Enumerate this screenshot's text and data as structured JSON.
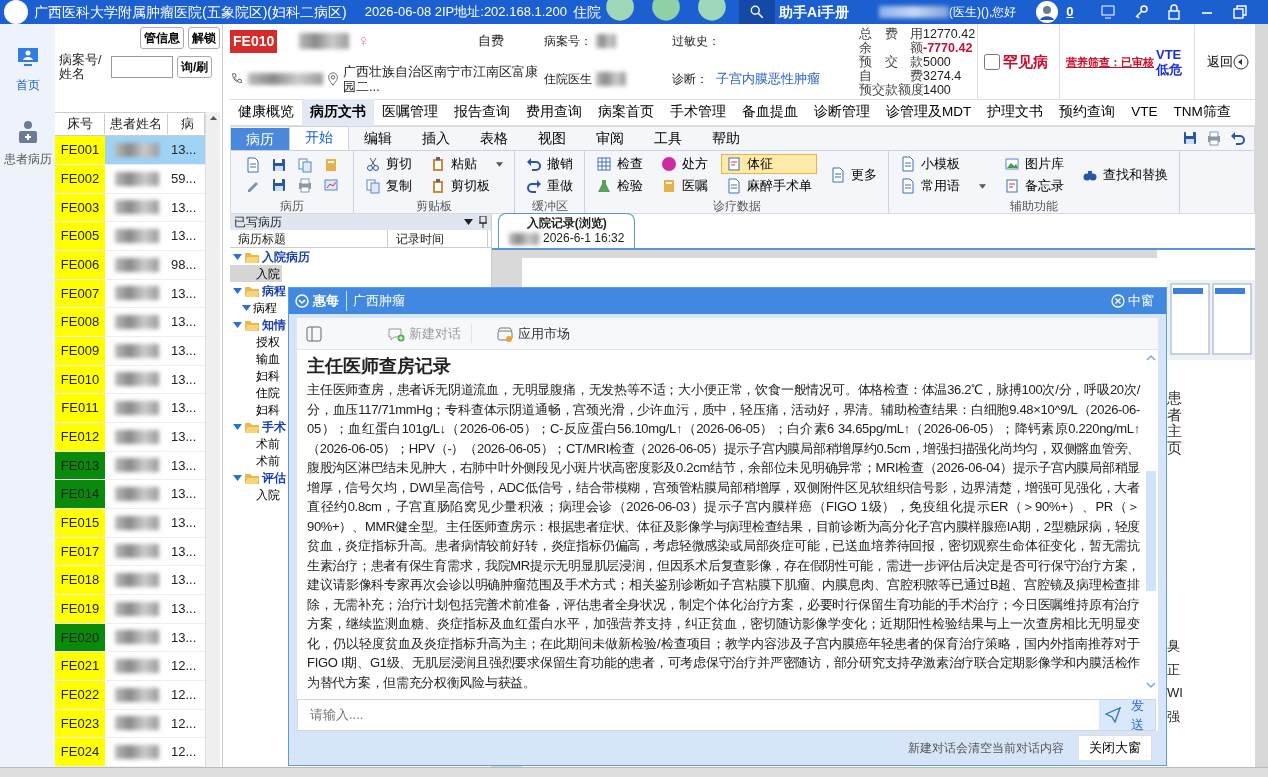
{
  "titlebar": {
    "title": "广西医科大学附属肿瘤医院(五象院区)(妇科二病区)",
    "info": "2026-06-08 2IP地址:202.168.1.200",
    "ward": "住院",
    "assistant": "助手Ai手册",
    "greeting": "(医生)(),您好",
    "notifications": "0"
  },
  "nav": [
    {
      "label": "首页",
      "selected": true
    },
    {
      "label": "患者病历",
      "selected": false
    }
  ],
  "patient_panel": {
    "buttons": [
      "管信息",
      "解锁"
    ],
    "search_label": "病案号/姓名",
    "search_button": "询/刷",
    "columns": [
      "床号",
      "患者姓名",
      "病"
    ],
    "rows": [
      {
        "bed": "FE001",
        "col3": "13...",
        "color": "#ffff00",
        "selected": true
      },
      {
        "bed": "FE002",
        "col3": "59...",
        "color": "#ffff00",
        "selected": false
      },
      {
        "bed": "FE003",
        "col3": "13...",
        "color": "#ffff00",
        "selected": false
      },
      {
        "bed": "FE005",
        "col3": "13...",
        "color": "#ffff00",
        "selected": false
      },
      {
        "bed": "FE006",
        "col3": "98...",
        "color": "#ffff00",
        "selected": false
      },
      {
        "bed": "FE007",
        "col3": "13...",
        "color": "#ffff00",
        "selected": false
      },
      {
        "bed": "FE008",
        "col3": "13...",
        "color": "#ffff00",
        "selected": false
      },
      {
        "bed": "FE009",
        "col3": "13...",
        "color": "#ffff00",
        "selected": false
      },
      {
        "bed": "FE010",
        "col3": "13...",
        "color": "#ffff00",
        "selected": false
      },
      {
        "bed": "FE011",
        "col3": "13...",
        "color": "#ffff00",
        "selected": false
      },
      {
        "bed": "FE012",
        "col3": "13...",
        "color": "#ffff00",
        "selected": false
      },
      {
        "bed": "FE013",
        "col3": "13...",
        "color": "#0a8a0a",
        "selected": false
      },
      {
        "bed": "FE014",
        "col3": "13...",
        "color": "#0a8a0a",
        "selected": false
      },
      {
        "bed": "FE015",
        "col3": "13...",
        "color": "#ffff00",
        "selected": false
      },
      {
        "bed": "FE017",
        "col3": "13...",
        "color": "#ffff00",
        "selected": false
      },
      {
        "bed": "FE018",
        "col3": "13...",
        "color": "#ffff00",
        "selected": false
      },
      {
        "bed": "FE019",
        "col3": "13...",
        "color": "#ffff00",
        "selected": false
      },
      {
        "bed": "FE020",
        "col3": "13...",
        "color": "#0a8a0a",
        "selected": false
      },
      {
        "bed": "FE021",
        "col3": "12...",
        "color": "#ffff00",
        "selected": false
      },
      {
        "bed": "FE022",
        "col3": "12...",
        "color": "#ffff00",
        "selected": false
      },
      {
        "bed": "FE023",
        "col3": "12...",
        "color": "#ffff00",
        "selected": false
      },
      {
        "bed": "FE024",
        "col3": "12...",
        "color": "#ffff00",
        "selected": false
      }
    ]
  },
  "patient": {
    "bed": "FE010",
    "gender": "♀",
    "payment": "自费",
    "record_label": "病案号：",
    "allergy_label": "过敏史：",
    "address": "广西壮族自治区南宁市江南区富康园二...",
    "doctor_label": "住院医生",
    "diagnosis_label": "诊断：",
    "diagnosis": "子宫内膜恶性肿瘤",
    "fees": [
      {
        "label": "总费用",
        "value": "12770.42",
        "negative": false
      },
      {
        "label": "余额",
        "value": "-7770.42",
        "negative": true
      },
      {
        "label": "预交款",
        "value": "5000",
        "negative": false
      },
      {
        "label": "自费",
        "value": "3274.4",
        "negative": false
      },
      {
        "label": "预交款额度",
        "value": "1400",
        "negative": false
      }
    ],
    "rare_disease": {
      "label": "罕见病",
      "checked": false
    },
    "nutrition": "营养筛查：已审核",
    "vte": "VTE低危",
    "back": "返回"
  },
  "module_tabs": [
    {
      "label": "健康概览",
      "selected": false
    },
    {
      "label": "病历文书",
      "selected": true
    },
    {
      "label": "医嘱管理",
      "selected": false
    },
    {
      "label": "报告查询",
      "selected": false
    },
    {
      "label": "费用查询",
      "selected": false
    },
    {
      "label": "病案首页",
      "selected": false
    },
    {
      "label": "手术管理",
      "selected": false
    },
    {
      "label": "备血提血",
      "selected": false
    },
    {
      "label": "诊断管理",
      "selected": false
    },
    {
      "label": "诊管理及MDT",
      "selected": false
    },
    {
      "label": "护理文书",
      "selected": false
    },
    {
      "label": "预约查询",
      "selected": false
    },
    {
      "label": "VTE",
      "selected": false
    },
    {
      "label": "TNM筛查",
      "selected": false
    }
  ],
  "ribbon": {
    "app_tab": "病历",
    "tabs": [
      {
        "label": "开始",
        "selected": true
      },
      {
        "label": "编辑",
        "selected": false
      },
      {
        "label": "插入",
        "selected": false
      },
      {
        "label": "表格",
        "selected": false
      },
      {
        "label": "视图",
        "selected": false
      },
      {
        "label": "审阅",
        "selected": false
      },
      {
        "label": "工具",
        "selected": false
      },
      {
        "label": "帮助",
        "selected": false
      }
    ],
    "groups": [
      {
        "title": "病历",
        "kind": "icons"
      },
      {
        "title": "剪贴板",
        "kind": "buttons",
        "columns": [
          [
            {
              "label": "剪切"
            },
            {
              "label": "复制"
            }
          ],
          [
            {
              "label": "粘贴",
              "dropdown": true
            },
            {
              "label": "剪切板"
            }
          ]
        ]
      },
      {
        "title": "缓冲区",
        "kind": "buttons",
        "columns": [
          [
            {
              "label": "撤销"
            },
            {
              "label": "重做"
            }
          ]
        ]
      },
      {
        "title": "诊疗数据",
        "kind": "buttons",
        "columns": [
          [
            {
              "label": "检查"
            },
            {
              "label": "检验"
            }
          ],
          [
            {
              "label": "处方"
            },
            {
              "label": "医嘱"
            }
          ],
          [
            {
              "label": "体征",
              "highlighted": true
            },
            {
              "label": "麻醉手术单"
            }
          ],
          [
            {
              "label": "更多"
            }
          ]
        ]
      },
      {
        "title": "辅助功能",
        "kind": "buttons",
        "columns": [
          [
            {
              "label": "小模板"
            },
            {
              "label": "常用语",
              "dropdown": true
            }
          ],
          [
            {
              "label": "图片库"
            },
            {
              "label": "备忘录"
            }
          ],
          [
            {
              "label": "查找和替换"
            }
          ]
        ]
      }
    ]
  },
  "record_tree": {
    "title": "已写病历",
    "columns": [
      "病历标题",
      "记录时间"
    ],
    "items": [
      {
        "label": "入院病历",
        "expanded": true,
        "selected": false,
        "children": [
          {
            "label": "入院",
            "selected": true
          }
        ]
      },
      {
        "label": "病程",
        "expanded": true,
        "selected": false,
        "children": [
          {
            "label": "病程",
            "expanded": true,
            "selected": false
          }
        ]
      },
      {
        "label": "知情",
        "expanded": true,
        "selected": false,
        "children": [
          {
            "label": "授权",
            "selected": false
          },
          {
            "label": "输血",
            "selected": false
          },
          {
            "label": "妇科",
            "selected": false
          },
          {
            "label": "住院",
            "selected": false
          },
          {
            "label": "妇科",
            "selected": false
          }
        ]
      },
      {
        "label": "手术",
        "expanded": true,
        "selected": false,
        "children": [
          {
            "label": "术前",
            "selected": false
          },
          {
            "label": "术前",
            "selected": false
          }
        ]
      },
      {
        "label": "评估",
        "expanded": true,
        "selected": false,
        "children": [
          {
            "label": "入院",
            "selected": false
          }
        ]
      }
    ]
  },
  "document_tab": {
    "title": "入院记录(浏览)",
    "time": "2026-6-1 16:32"
  },
  "side": {
    "label": "患者主页",
    "fragments": [
      "臭",
      "正",
      "WI",
      "强"
    ]
  },
  "assistant": {
    "brand": "惠每",
    "org": "广西肿瘤",
    "size_button": "中窗",
    "toolbar": [
      {
        "label": "新建对话",
        "disabled": true
      },
      {
        "label": "应用市场",
        "disabled": false
      }
    ],
    "title": "主任医师查房记录",
    "body": "主任医师查房，患者诉无阴道流血，无明显腹痛，无发热等不适；大小便正常，饮食一般情况可。体格检查：体温36.2℃，脉搏100次/分，呼吸20次/分，血压117/71mmHg；专科查体示阴道通畅，宫颈光滑，少许血污，质中，轻压痛，活动好，界清。辅助检查结果：白细胞9.48×10^9/L（2026-06-05）；血红蛋白101g/L↓（2026-06-05）；C-反应蛋白56.10mg/L↑（2026-06-05）；白介素6 34.65pg/mL↑（2026-06-05）；降钙素原0.220ng/mL↑（2026-06-05）；HPV（-）（2026-06-05）；CT/MRI检查（2026-06-05）提示子宫内膜局部稍增厚约0.5cm，增强扫描强化尚均匀，双侧髂血管旁、腹股沟区淋巴结未见肿大，右肺中叶外侧段见小斑片状高密度影及0.2cm结节，余部位未见明确异常；MRI检查（2026-06-04）提示子宫内膜局部稍显增厚，信号欠均，DWI呈高信号，ADC低信号，结合带模糊，宫颈管粘膜局部稍增厚，双侧附件区见软组织信号影，边界清楚，增强可见强化，大者直径约0.8cm，子宫直肠陷窝见少量积液；病理会诊（2026-06-03）提示子宫内膜样癌（FIGO 1级），免疫组化提示ER（＞90%+）、PR（＞90%+）、MMR健全型。主任医师查房示：根据患者症状、体征及影像学与病理检查结果，目前诊断为高分化子宫内膜样腺癌IA期，2型糖尿病，轻度贫血，炎症指标升高。患者病情较前好转，炎症指标仍偏高，考虑轻微感染或局部炎症可能，已送血培养待回报，密切观察生命体征变化，暂无需抗生素治疗；患者有保生育需求，我院MR提示无明显肌层浸润，但因系术后复查影像，存在假阴性可能，需进一步评估后决定是否可行保守治疗方案，建议请影像科专家再次会诊以明确肿瘤范围及手术方式；相关鉴别诊断如子宫粘膜下肌瘤、内膜息肉、宫腔积脓等已通过B超、宫腔镜及病理检查排除，无需补充；治疗计划包括完善术前准备，评估患者全身状况，制定个体化治疗方案，必要时行保留生育功能的手术治疗；今日医嘱维持原有治疗方案，继续监测血糖、炎症指标及血红蛋白水平，加强营养支持，纠正贫血，密切随访影像学变化；近期阳性检验结果与上一次查房相比无明显变化，仍以轻度贫血及炎症指标升高为主；在此期间未做新检验/检查项目；教学内容涉及子宫内膜癌年轻患者的保育治疗策略，国内外指南推荐对于FIGO I期、G1级、无肌层浸润且强烈要求保留生育功能的患者，可考虑保守治疗并严密随访，部分研究支持孕激素治疗联合定期影像学和内膜活检作为替代方案，但需充分权衡风险与获益。",
    "input": {
      "placeholder": "请输入...."
    },
    "send": "发送",
    "footer_note": "新建对话会清空当前对话内容",
    "close": "关闭大窗"
  }
}
